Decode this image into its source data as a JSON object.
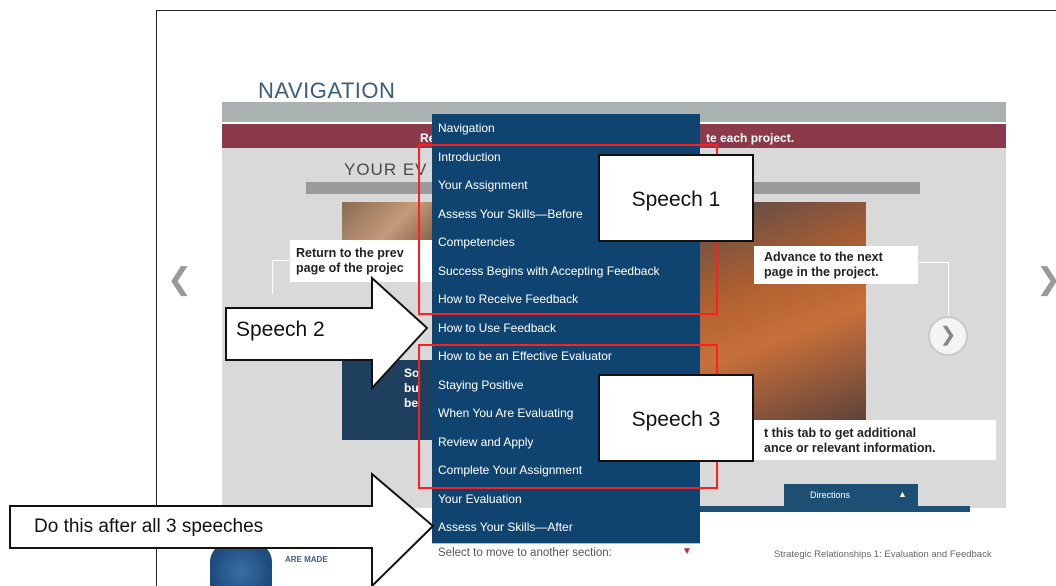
{
  "page": {
    "title": "NAVIGATION",
    "banner_left": "Re",
    "banner_right": "te each project.",
    "section_heading": "YOUR EV",
    "callout_prev_line1": "Return to the prev",
    "callout_prev_line2": "page of the projec",
    "callout_next_line1": "Advance to the next",
    "callout_next_line2": "page in the project.",
    "callout_tab_line1": "t this tab to get additional",
    "callout_tab_line2": "ance or relevant information.",
    "dark_panel_line1": "So",
    "dark_panel_line2": "bu",
    "dark_panel_line3": "be",
    "next_circle_glyph": "❯",
    "prev_arrow_glyph": "❮",
    "next_arrow_glyph": "❯",
    "directions_tab": "Directions",
    "directions_caret": "▲",
    "footer_text": "Strategic Relationships 1: Evaluation and Feedback",
    "logo_text": "ARE MADE"
  },
  "dropdown": {
    "items": [
      "Navigation",
      "Introduction",
      "Your Assignment",
      "Assess Your Skills—Before",
      "Competencies",
      "Success Begins with Accepting Feedback",
      "How to Receive Feedback",
      "How to Use Feedback",
      "How to be an Effective Evaluator",
      "Staying Positive",
      "When You Are Evaluating",
      "Review and Apply",
      "Complete Your Assignment",
      "Your Evaluation",
      "Assess Your Skills—After"
    ],
    "select_placeholder": "Select to move to another section:",
    "select_arrow": "▼"
  },
  "annotations": {
    "speech1": "Speech 1",
    "speech2": "Speech 2",
    "speech3": "Speech 3",
    "after_all": "Do this after all 3 speeches",
    "box_color": "#ff1f1f"
  },
  "colors": {
    "dropdown_bg": "#0f4470",
    "banner": "#8a3a4a",
    "title": "#3b5e7a"
  }
}
